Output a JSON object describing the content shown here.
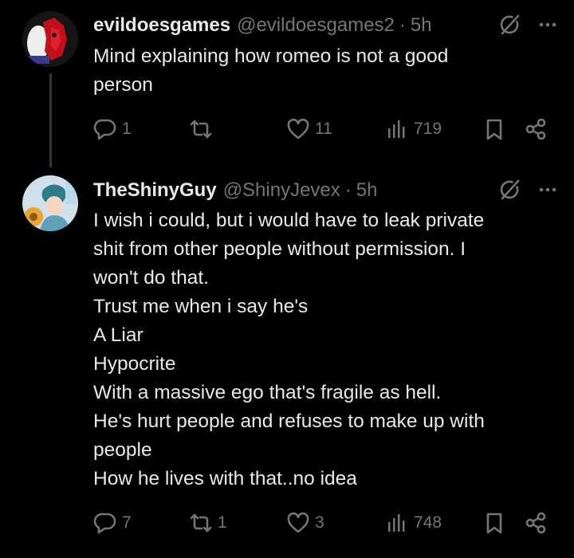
{
  "tweets": [
    {
      "display_name": "evildoesgames",
      "handle": "@evildoesgames2",
      "separator": "·",
      "time": "5h",
      "lines": [
        "Mind explaining how romeo is not a good",
        "person"
      ],
      "stats": {
        "replies": "1",
        "retweets": "",
        "likes": "11",
        "views": "719"
      }
    },
    {
      "display_name": "TheShinyGuy",
      "handle": "@ShinyJevex",
      "separator": "·",
      "time": "5h",
      "lines": [
        "I wish i could, but i would have to leak private",
        "shit from other people without permission. I",
        "won't do that.",
        "Trust me when i say he's",
        "A Liar",
        "Hypocrite",
        "With a massive ego that's fragile as hell.",
        "He's hurt people and refuses to make up with",
        "people",
        "How he lives with that..no idea"
      ],
      "stats": {
        "replies": "7",
        "retweets": "1",
        "likes": "3",
        "views": "748"
      }
    }
  ],
  "colors": {
    "background": "#000000",
    "text": "#e7e9ea",
    "muted": "#71767b",
    "thread_line": "#333639"
  },
  "icons": [
    "reply-icon",
    "retweet-icon",
    "like-icon",
    "views-icon",
    "bookmark-icon",
    "share-icon",
    "grok-icon",
    "more-icon"
  ]
}
